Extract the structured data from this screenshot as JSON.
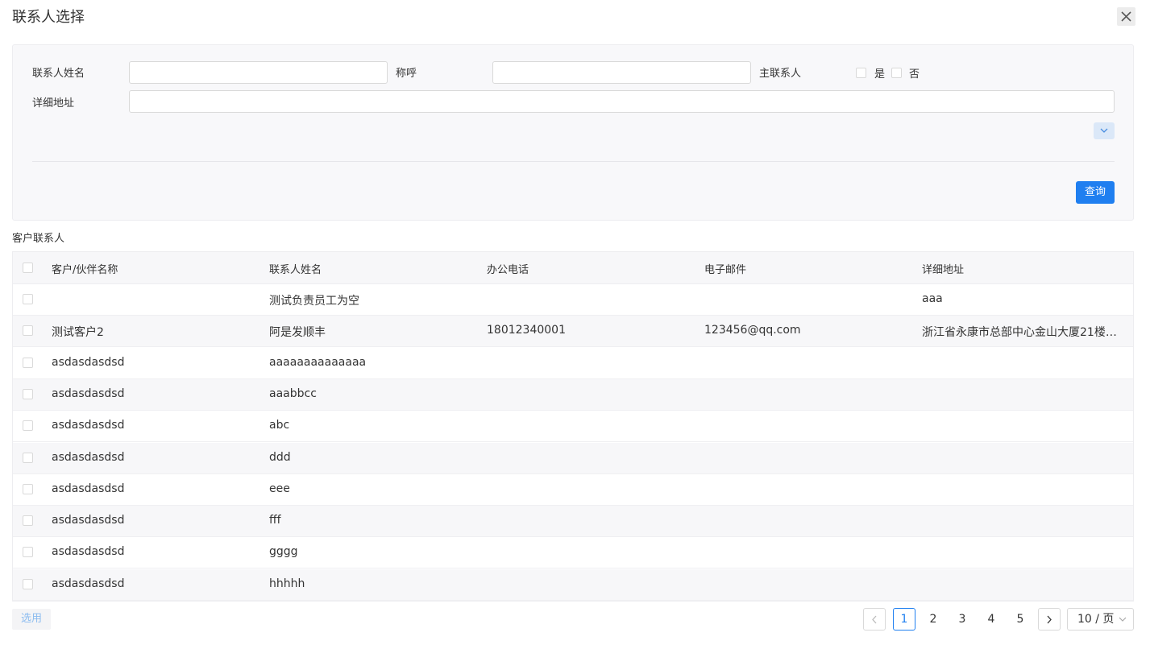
{
  "dialog": {
    "title": "联系人选择"
  },
  "filters": {
    "name_label": "联系人姓名",
    "salutation_label": "称呼",
    "primary_label": "主联系人",
    "primary_yes": "是",
    "primary_no": "否",
    "address_label": "详细地址",
    "name_value": "",
    "salutation_value": "",
    "address_value": "",
    "query_label": "查询"
  },
  "section": {
    "title": "客户联系人"
  },
  "table": {
    "columns": [
      "客户/伙伴名称",
      "联系人姓名",
      "办公电话",
      "电子邮件",
      "详细地址"
    ],
    "rows": [
      [
        "",
        "测试负责员工为空",
        "",
        "",
        "aaa"
      ],
      [
        "测试客户2",
        "阿是发顺丰",
        "18012340001",
        "123456@qq.com",
        "浙江省永康市总部中心金山大厦21楼2..."
      ],
      [
        "asdasdasdsd",
        "aaaaaaaaaaaaaa",
        "",
        "",
        ""
      ],
      [
        "asdasdasdsd",
        "aaabbcc",
        "",
        "",
        ""
      ],
      [
        "asdasdasdsd",
        "abc",
        "",
        "",
        ""
      ],
      [
        "asdasdasdsd",
        "ddd",
        "",
        "",
        ""
      ],
      [
        "asdasdasdsd",
        "eee",
        "",
        "",
        ""
      ],
      [
        "asdasdasdsd",
        "fff",
        "",
        "",
        ""
      ],
      [
        "asdasdasdsd",
        "gggg",
        "",
        "",
        ""
      ],
      [
        "asdasdasdsd",
        "hhhhh",
        "",
        "",
        ""
      ]
    ]
  },
  "footer": {
    "select_label": "选用",
    "pages": [
      "1",
      "2",
      "3",
      "4",
      "5"
    ],
    "current_page": "1",
    "page_size": "10 / 页"
  },
  "colors": {
    "accent": "#1f7ff0",
    "panel_bg": "#f8f8fa",
    "zebra": "#f7f7f9"
  }
}
